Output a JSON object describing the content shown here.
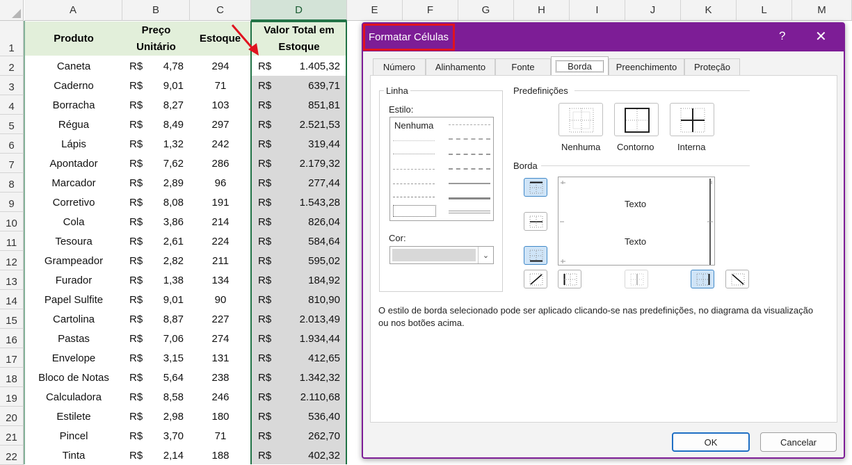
{
  "sheet": {
    "columns": [
      "A",
      "B",
      "C",
      "D",
      "E",
      "F",
      "G",
      "H",
      "I",
      "J",
      "K",
      "L",
      "M"
    ],
    "row_numbers": [
      "1",
      "2",
      "3",
      "4",
      "5",
      "6",
      "7",
      "8",
      "9",
      "10",
      "11",
      "12",
      "13",
      "14",
      "15",
      "16",
      "17",
      "18",
      "19",
      "20",
      "21",
      "22"
    ],
    "headers": {
      "produto": "Produto",
      "preco_line1": "Preço",
      "preco_line2": "Unitário",
      "estoque": "Estoque",
      "valor_line1": "Valor Total em",
      "valor_line2": "Estoque"
    },
    "rows": [
      {
        "produto": "Caneta",
        "moeda": "R$",
        "preco": "4,78",
        "estoque": "294",
        "moeda_total": "R$",
        "total": "1.405,32"
      },
      {
        "produto": "Caderno",
        "moeda": "R$",
        "preco": "9,01",
        "estoque": "71",
        "moeda_total": "R$",
        "total": "639,71"
      },
      {
        "produto": "Borracha",
        "moeda": "R$",
        "preco": "8,27",
        "estoque": "103",
        "moeda_total": "R$",
        "total": "851,81"
      },
      {
        "produto": "Régua",
        "moeda": "R$",
        "preco": "8,49",
        "estoque": "297",
        "moeda_total": "R$",
        "total": "2.521,53"
      },
      {
        "produto": "Lápis",
        "moeda": "R$",
        "preco": "1,32",
        "estoque": "242",
        "moeda_total": "R$",
        "total": "319,44"
      },
      {
        "produto": "Apontador",
        "moeda": "R$",
        "preco": "7,62",
        "estoque": "286",
        "moeda_total": "R$",
        "total": "2.179,32"
      },
      {
        "produto": "Marcador",
        "moeda": "R$",
        "preco": "2,89",
        "estoque": "96",
        "moeda_total": "R$",
        "total": "277,44"
      },
      {
        "produto": "Corretivo",
        "moeda": "R$",
        "preco": "8,08",
        "estoque": "191",
        "moeda_total": "R$",
        "total": "1.543,28"
      },
      {
        "produto": "Cola",
        "moeda": "R$",
        "preco": "3,86",
        "estoque": "214",
        "moeda_total": "R$",
        "total": "826,04"
      },
      {
        "produto": "Tesoura",
        "moeda": "R$",
        "preco": "2,61",
        "estoque": "224",
        "moeda_total": "R$",
        "total": "584,64"
      },
      {
        "produto": "Grampeador",
        "moeda": "R$",
        "preco": "2,82",
        "estoque": "211",
        "moeda_total": "R$",
        "total": "595,02"
      },
      {
        "produto": "Furador",
        "moeda": "R$",
        "preco": "1,38",
        "estoque": "134",
        "moeda_total": "R$",
        "total": "184,92"
      },
      {
        "produto": "Papel Sulfite",
        "moeda": "R$",
        "preco": "9,01",
        "estoque": "90",
        "moeda_total": "R$",
        "total": "810,90"
      },
      {
        "produto": "Cartolina",
        "moeda": "R$",
        "preco": "8,87",
        "estoque": "227",
        "moeda_total": "R$",
        "total": "2.013,49"
      },
      {
        "produto": "Pastas",
        "moeda": "R$",
        "preco": "7,06",
        "estoque": "274",
        "moeda_total": "R$",
        "total": "1.934,44"
      },
      {
        "produto": "Envelope",
        "moeda": "R$",
        "preco": "3,15",
        "estoque": "131",
        "moeda_total": "R$",
        "total": "412,65"
      },
      {
        "produto": "Bloco de Notas",
        "moeda": "R$",
        "preco": "5,64",
        "estoque": "238",
        "moeda_total": "R$",
        "total": "1.342,32"
      },
      {
        "produto": "Calculadora",
        "moeda": "R$",
        "preco": "8,58",
        "estoque": "246",
        "moeda_total": "R$",
        "total": "2.110,68"
      },
      {
        "produto": "Estilete",
        "moeda": "R$",
        "preco": "2,98",
        "estoque": "180",
        "moeda_total": "R$",
        "total": "536,40"
      },
      {
        "produto": "Pincel",
        "moeda": "R$",
        "preco": "3,70",
        "estoque": "71",
        "moeda_total": "R$",
        "total": "262,70"
      },
      {
        "produto": "Tinta",
        "moeda": "R$",
        "preco": "2,14",
        "estoque": "188",
        "moeda_total": "R$",
        "total": "402,32"
      }
    ]
  },
  "dialog": {
    "title": "Formatar Células",
    "help_glyph": "?",
    "close_glyph": "✕",
    "tabs": [
      "Número",
      "Alinhamento",
      "Fonte",
      "Borda",
      "Preenchimento",
      "Proteção"
    ],
    "active_tab": "Borda",
    "line_group_label": "Linha",
    "style_label": "Estilo:",
    "style_none": "Nenhuma",
    "color_label": "Cor:",
    "presets_label": "Predefinições",
    "presets": [
      "Nenhuma",
      "Contorno",
      "Interna"
    ],
    "border_label": "Borda",
    "preview_text_top": "Texto",
    "preview_text_bottom": "Texto",
    "hint": "O estilo de borda selecionado pode ser aplicado clicando-se nas predefinições, no diagrama da visualização ou nos botões acima.",
    "ok_label": "OK",
    "cancel_label": "Cancelar"
  },
  "colors": {
    "excel_green": "#217346",
    "header_fill": "#e2efda",
    "selection_fill": "#d9d9d9",
    "dialog_purple": "#7d1d96",
    "highlight_red": "#e0131f",
    "active_blue": "#cfe4f7"
  }
}
